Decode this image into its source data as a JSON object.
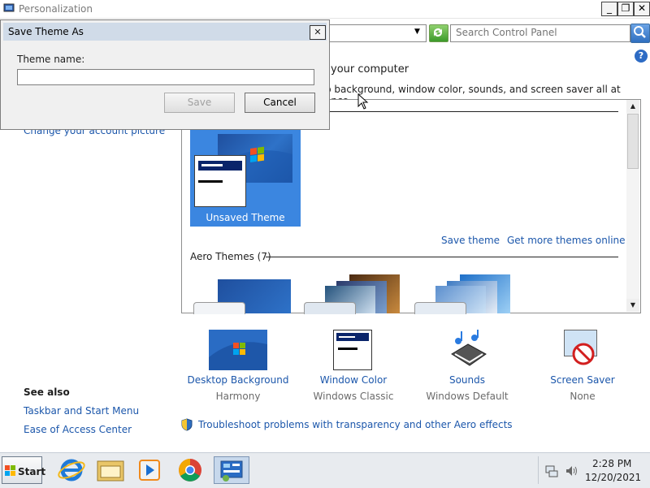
{
  "window": {
    "title": "Personalization"
  },
  "search": {
    "placeholder": "Search Control Panel"
  },
  "header": {
    "title": "your computer",
    "subtitle": "p background, window color, sounds, and screen saver all at once."
  },
  "left_panel": {
    "account_link": "Change your account picture",
    "see_also_title": "See also",
    "see_also_links": [
      "Taskbar and Start Menu",
      "Ease of Access Center"
    ]
  },
  "themes": {
    "unsaved_label": "Unsaved Theme",
    "save_theme_link": "Save theme",
    "more_themes_link": "Get more themes online",
    "aero_section": "Aero Themes (7)"
  },
  "settings": [
    {
      "title": "Desktop Background",
      "value": "Harmony"
    },
    {
      "title": "Window Color",
      "value": "Windows Classic"
    },
    {
      "title": "Sounds",
      "value": "Windows Default"
    },
    {
      "title": "Screen Saver",
      "value": "None"
    }
  ],
  "troubleshoot_link": "Troubleshoot problems with transparency and other Aero effects",
  "dialog": {
    "title": "Save Theme As",
    "label": "Theme name:",
    "value": "",
    "save_label": "Save",
    "cancel_label": "Cancel"
  },
  "taskbar": {
    "start_label": "Start",
    "time": "2:28 PM",
    "date": "12/20/2021"
  },
  "colors": {
    "link": "#1c57ab",
    "selected_theme": "#3b86e0",
    "dialog_title_bg": "#d0dbe8"
  },
  "icons": [
    "windows-flag-icon",
    "internet-explorer-icon",
    "file-explorer-icon",
    "media-player-icon",
    "chrome-icon",
    "control-panel-icon",
    "refresh-icon",
    "search-icon",
    "help-icon",
    "shield-icon",
    "network-icon",
    "volume-icon"
  ]
}
